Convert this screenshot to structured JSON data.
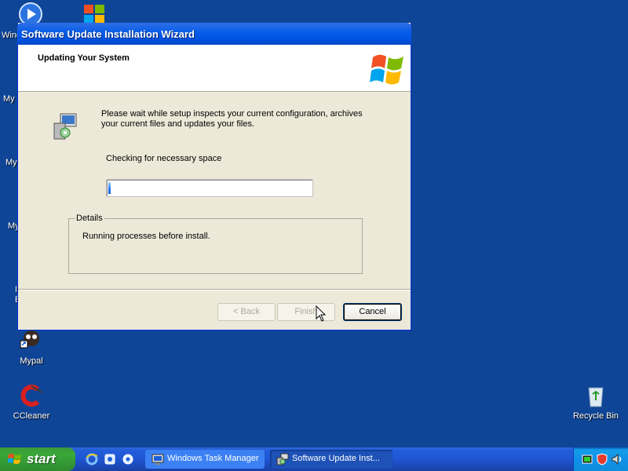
{
  "desktop": {
    "icons": [
      {
        "label": "Mypal"
      },
      {
        "label": "CCleaner"
      },
      {
        "label": "Recycle Bin"
      }
    ],
    "partial_labels": [
      "Wind",
      "My",
      "My",
      "My",
      "I",
      "E"
    ]
  },
  "window": {
    "title": "Software Update Installation Wizard",
    "header_title": "Updating Your System",
    "description": "Please wait while setup inspects your current configuration, archives your current files and updates your files.",
    "status": "Checking for necessary space",
    "progress_fraction": 0.01,
    "details_legend": "Details",
    "details_text": "Running processes before install.",
    "buttons": {
      "back": "< Back",
      "finish": "Finish",
      "cancel": "Cancel"
    }
  },
  "taskbar": {
    "start_label": "start",
    "tasks": [
      {
        "label": "Windows Task Manager"
      },
      {
        "label": "Software Update Inst..."
      }
    ]
  },
  "colors": {
    "desktop": "#0f4597",
    "title_bar": "#0055e5",
    "start_button": "#39a839"
  }
}
